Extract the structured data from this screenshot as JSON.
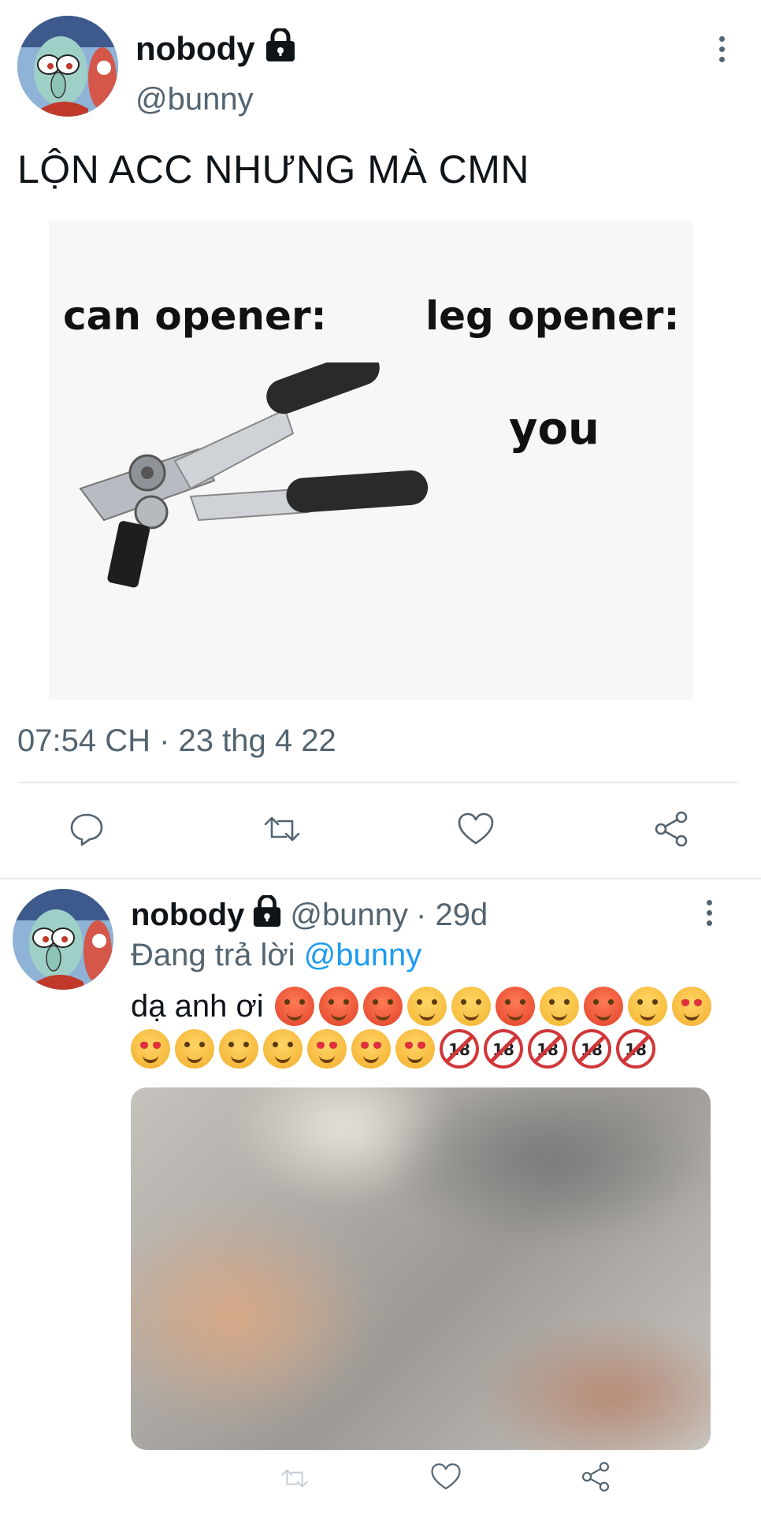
{
  "tweet": {
    "author_name": "nobody",
    "handle": "@bunny",
    "text": "LỘN ACC NHƯNG MÀ CMN",
    "meme": {
      "left_label": "can opener:",
      "right_label": "leg opener:",
      "answer": "you"
    },
    "timestamp": "07:54 CH · 23 thg 4 22",
    "actions": [
      "reply-icon",
      "retweet-icon",
      "like-icon",
      "share-icon"
    ]
  },
  "reply": {
    "author_name": "nobody",
    "handle": "@bunny",
    "age": "· 29d",
    "replying_prefix": "Đang trả lời",
    "replying_to": "@bunny",
    "text": "dạ anh ơi",
    "emoji_line1": [
      "hot-face",
      "hot-face",
      "hot-face",
      "drooling-face",
      "drooling-face",
      "hot-face",
      "drooling-face",
      "hot-face",
      "drooling-face",
      "heart-eyes-face"
    ],
    "emoji_line2": [
      "heart-eyes-face",
      "smiling-hearts-face",
      "smiling-hearts-face",
      "smiling-hearts-face",
      "star-struck-face",
      "star-struck-face",
      "star-struck-face",
      "no-under-18",
      "no-under-18",
      "no-under-18",
      "no-under-18",
      "no-under-18"
    ],
    "u18_text": "18",
    "actions": [
      "retweet-icon",
      "like-icon",
      "share-icon"
    ]
  },
  "colors": {
    "text": "#0f1419",
    "secondary": "#536471",
    "link": "#1d9bf0",
    "divider": "#e6e9ec"
  }
}
